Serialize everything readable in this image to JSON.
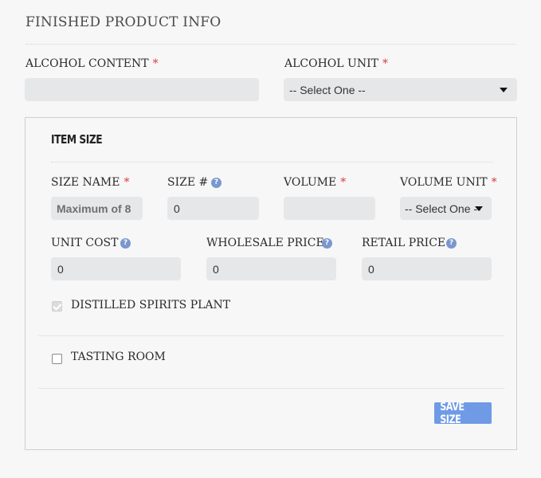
{
  "section": {
    "title": "FINISHED PRODUCT INFO"
  },
  "alcohol_content": {
    "label": "ALCOHOL CONTENT",
    "required": "*",
    "value": ""
  },
  "alcohol_unit": {
    "label": "ALCOHOL UNIT",
    "required": "*",
    "selected": "-- Select One --"
  },
  "item_size": {
    "title": "ITEM SIZE",
    "size_name": {
      "label": "SIZE NAME",
      "required": "*",
      "placeholder": "Maximum of 8"
    },
    "size_number": {
      "label": "SIZE #",
      "value": "0"
    },
    "volume": {
      "label": "VOLUME",
      "required": "*",
      "value": ""
    },
    "volume_unit": {
      "label": "VOLUME UNIT",
      "required": "*",
      "selected": "-- Select One --"
    },
    "unit_cost": {
      "label": "UNIT COST",
      "value": "0"
    },
    "wholesale_price": {
      "label": "WHOLESALE PRICE",
      "value": "0"
    },
    "retail_price": {
      "label": "RETAIL PRICE",
      "value": "0"
    },
    "distilled_spirits_plant": {
      "label": "DISTILLED SPIRITS PLANT",
      "checked": true,
      "disabled": true
    },
    "tasting_room": {
      "label": "TASTING ROOM",
      "checked": false
    },
    "save_label": "SAVE SIZE"
  },
  "info_icon_glyph": "?",
  "colors": {
    "accent": "#6f9be6",
    "required": "#d33c3c",
    "info_icon": "#7a97cf",
    "field_bg": "#e6e7e8"
  },
  "icons": {
    "info": "question-circle-icon",
    "select": "caret-down-icon",
    "checkbox": "checkbox-icon"
  }
}
